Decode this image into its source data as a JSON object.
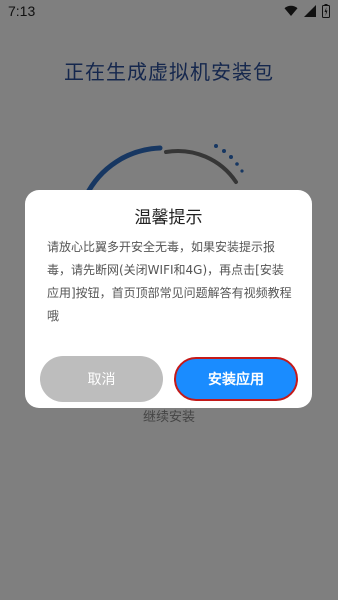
{
  "status_bar": {
    "time": "7:13",
    "icons": [
      "wifi-icon",
      "signal-icon",
      "battery-icon"
    ]
  },
  "page": {
    "title": "正在生成虚拟机安装包",
    "continue_label": "继续安装"
  },
  "dialog": {
    "title": "温馨提示",
    "message": "请放心比翼多开安全无毒，如果安装提示报毒，请先断网(关闭WIFI和4G)，再点击[安装应用]按钮，首页顶部常见问题解答有视频教程哦",
    "cancel_label": "取消",
    "install_label": "安装应用"
  },
  "colors": {
    "title_blue": "#2b4f9a",
    "ring_blue": "#2f6fc4",
    "ring_gray": "#6d6d6d",
    "install_blue": "#1a8cff",
    "cancel_gray": "#bdbdbd",
    "highlight_red": "#c41a1a"
  }
}
